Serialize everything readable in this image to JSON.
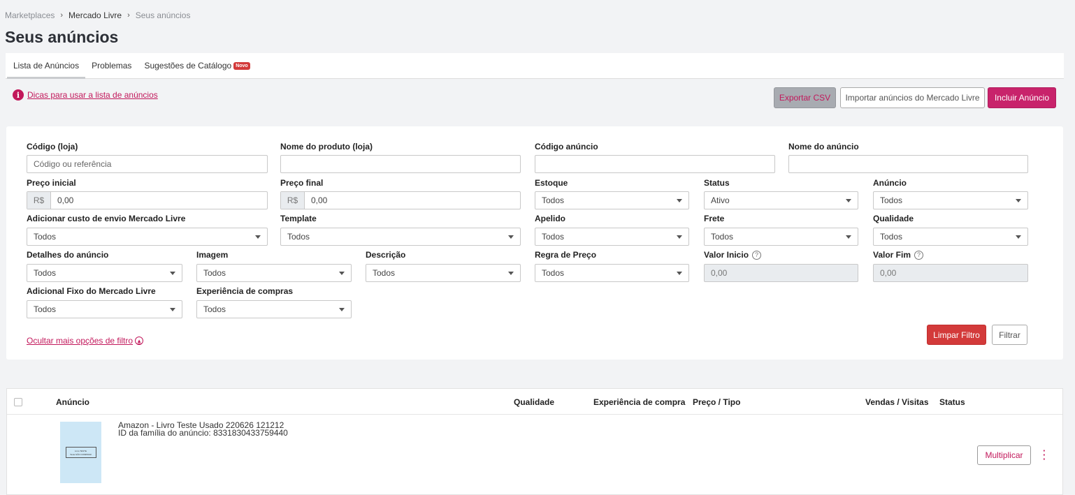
{
  "breadcrumb": {
    "item1": "Marketplaces",
    "item2": "Mercado Livre",
    "item3": "Seus anúncios",
    "separator": "›"
  },
  "page_title": "Seus anúncios",
  "tabs": [
    {
      "label": "Lista de Anúncios"
    },
    {
      "label": "Problemas"
    },
    {
      "label": "Sugestões de Catálogo",
      "badge": "Novo"
    }
  ],
  "tips": {
    "icon": "i",
    "link": "Dicas para usar a lista de anúncios"
  },
  "actions": {
    "export": "Exportar CSV",
    "import": "Importar anúncios do Mercado Livre",
    "include": "Incluir Anúncio"
  },
  "filters": {
    "codigo_loja": {
      "label": "Código (loja)",
      "placeholder": "Código ou referência"
    },
    "nome_produto": {
      "label": "Nome do produto (loja)",
      "value": ""
    },
    "codigo_anuncio": {
      "label": "Código anúncio",
      "value": ""
    },
    "nome_anuncio": {
      "label": "Nome do anúncio",
      "value": ""
    },
    "preco_inicial": {
      "label": "Preço inicial",
      "prefix": "R$",
      "value": "0,00"
    },
    "preco_final": {
      "label": "Preço final",
      "prefix": "R$",
      "value": "0,00"
    },
    "estoque": {
      "label": "Estoque",
      "value": "Todos"
    },
    "status": {
      "label": "Status",
      "value": "Ativo"
    },
    "anuncio": {
      "label": "Anúncio",
      "value": "Todos"
    },
    "custo_envio": {
      "label": "Adicionar custo de envio Mercado Livre",
      "value": "Todos"
    },
    "template": {
      "label": "Template",
      "value": "Todos"
    },
    "apelido": {
      "label": "Apelido",
      "value": "Todos"
    },
    "frete": {
      "label": "Frete",
      "value": "Todos"
    },
    "qualidade": {
      "label": "Qualidade",
      "value": "Todos"
    },
    "detalhes": {
      "label": "Detalhes do anúncio",
      "value": "Todos"
    },
    "imagem": {
      "label": "Imagem",
      "value": "Todos"
    },
    "descricao": {
      "label": "Descrição",
      "value": "Todos"
    },
    "regra_preco": {
      "label": "Regra de Preço",
      "value": "Todos"
    },
    "valor_inicio": {
      "label": "Valor Inicio",
      "value": "0,00",
      "help": "?"
    },
    "valor_fim": {
      "label": "Valor Fim",
      "value": "0,00",
      "help": "?"
    },
    "adicional_fixo": {
      "label": "Adicional Fixo do Mercado Livre",
      "value": "Todos"
    },
    "experiencia": {
      "label": "Experiência de compras",
      "value": "Todos"
    }
  },
  "filter_actions": {
    "hide_link": "Ocultar mais opções de filtro",
    "clear": "Limpar Filtro",
    "filter": "Filtrar"
  },
  "table": {
    "headers": {
      "anuncio": "Anúncio",
      "qualidade": "Qualidade",
      "experiencia": "Experiência de compra",
      "preco": "Preço / Tipo",
      "vendas": "Vendas / Visitas",
      "status": "Status"
    },
    "rows": [
      {
        "title": "Amazon - Livro Teste Usado 220626 121212",
        "family_id": "ID da família do anúncio: 8331830433759440",
        "thumb_line1": "Livro TESTE",
        "thumb_line2": "Teste NÃO COMPRAR",
        "multiply": "Multiplicar"
      }
    ]
  }
}
